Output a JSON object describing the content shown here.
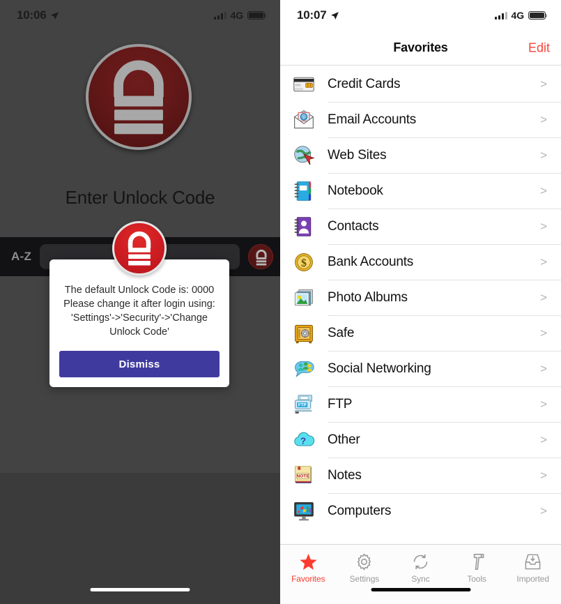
{
  "left": {
    "status": {
      "time": "10:06",
      "network": "4G",
      "location_icon": "location-arrow-icon"
    },
    "lock_icon": "padlock-icon",
    "title": "Enter Unlock Code",
    "toolbar": {
      "sort_label": "A-Z",
      "field_value": "",
      "lock_button_icon": "padlock-icon"
    },
    "alert": {
      "icon": "padlock-icon",
      "message": "The default Unlock Code is: 0000\nPlease change it after login using:\n'Settings'->'Security'->'Change Unlock Code'",
      "dismiss_label": "Dismiss",
      "button_color": "#3f3b9e"
    }
  },
  "right": {
    "status": {
      "time": "10:07",
      "network": "4G",
      "location_icon": "location-arrow-icon"
    },
    "nav": {
      "title": "Favorites",
      "edit_label": "Edit",
      "edit_color": "#f8453a"
    },
    "items": [
      {
        "label": "Credit Cards",
        "icon": "credit-card-icon",
        "chevron": ">"
      },
      {
        "label": "Email Accounts",
        "icon": "envelope-at-icon",
        "chevron": ">"
      },
      {
        "label": "Web Sites",
        "icon": "globe-cursor-icon",
        "chevron": ">"
      },
      {
        "label": "Notebook",
        "icon": "notebook-icon",
        "chevron": ">"
      },
      {
        "label": "Contacts",
        "icon": "address-book-icon",
        "chevron": ">"
      },
      {
        "label": "Bank Accounts",
        "icon": "dollar-coin-icon",
        "chevron": ">"
      },
      {
        "label": "Photo Albums",
        "icon": "photo-stack-icon",
        "chevron": ">"
      },
      {
        "label": "Safe",
        "icon": "safe-icon",
        "chevron": ">"
      },
      {
        "label": "Social Networking",
        "icon": "people-bubble-icon",
        "chevron": ">"
      },
      {
        "label": "FTP",
        "icon": "ftp-server-icon",
        "chevron": ">"
      },
      {
        "label": "Other",
        "icon": "cloud-question-icon",
        "chevron": ">"
      },
      {
        "label": "Notes",
        "icon": "sticky-note-icon",
        "chevron": ">"
      },
      {
        "label": "Computers",
        "icon": "monitor-icon",
        "chevron": ">"
      }
    ],
    "tabs": [
      {
        "label": "Favorites",
        "icon": "star-icon",
        "active": true
      },
      {
        "label": "Settings",
        "icon": "gear-icon",
        "active": false
      },
      {
        "label": "Sync",
        "icon": "sync-icon",
        "active": false
      },
      {
        "label": "Tools",
        "icon": "hammer-icon",
        "active": false
      },
      {
        "label": "Imported",
        "icon": "inbox-icon",
        "active": false
      }
    ]
  }
}
